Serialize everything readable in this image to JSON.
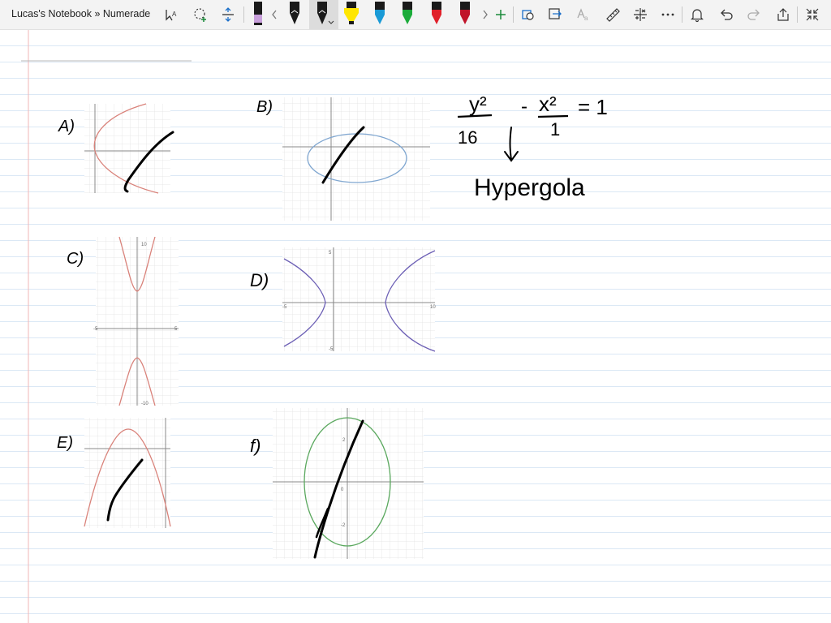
{
  "window": {
    "title": "Lucas's Notebook » Numerade"
  },
  "toolbar": {
    "tools": [
      {
        "name": "lasso-select-icon"
      },
      {
        "name": "add-shape-icon"
      },
      {
        "name": "insert-space-icon"
      },
      {
        "name": "pen-icon",
        "color": "#c9a0dc"
      },
      {
        "name": "pen-icon",
        "color": "#1a1a1a"
      },
      {
        "name": "pen-icon",
        "color": "#1a1a1a",
        "selected": true
      },
      {
        "name": "highlighter-icon",
        "color": "#ffe600"
      },
      {
        "name": "pen-icon",
        "color": "#1a9ad6"
      },
      {
        "name": "pen-icon",
        "color": "#1bab3a"
      },
      {
        "name": "pen-icon",
        "color": "#e0202a"
      },
      {
        "name": "pen-icon",
        "color": "#c0142a"
      }
    ]
  },
  "notebook": {
    "labels": {
      "a": "A)",
      "b": "B)",
      "c": "C)",
      "d": "D)",
      "e": "E)",
      "f": "f)"
    },
    "equation": {
      "num1": "y²",
      "den1": "16",
      "minus": "-",
      "num2": "x²",
      "den2": "1",
      "equals": "= 1"
    },
    "answer": "Hypergola",
    "graph_ticks": {
      "c_top": "10",
      "c_left": "-5",
      "c_right": "5",
      "c_bottom": "-10",
      "d_top": "5",
      "d_left": "-5",
      "d_right": "10",
      "d_bottom": "-5",
      "f_top": "2",
      "f_bottom": "-2",
      "f_zero": "0"
    }
  },
  "colors": {
    "margin_line": "#f2b6b6",
    "rule_line": "#dbe8f5",
    "graph_red": "#d9827a",
    "graph_blue": "#7fa6d0",
    "graph_purple": "#6c5fb5",
    "graph_green": "#5aa85e",
    "ink": "#000000"
  }
}
